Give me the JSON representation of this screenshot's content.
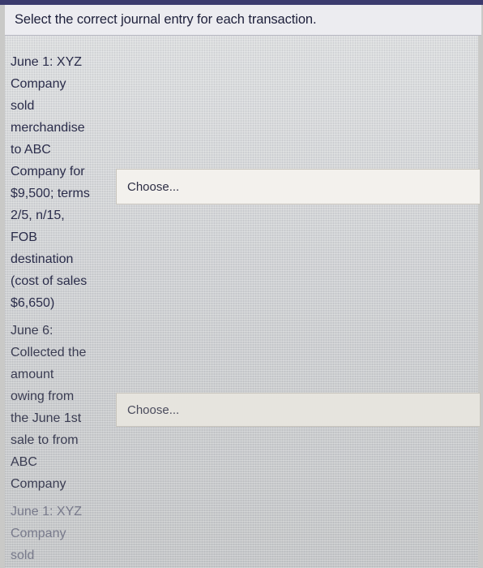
{
  "header": {
    "instruction": "Select the correct journal entry for each transaction."
  },
  "questions": [
    {
      "lines": [
        "June 1: XYZ",
        "Company",
        "sold",
        "merchandise",
        "to ABC",
        "Company for",
        "$9,500; terms",
        "2/5, n/15,",
        "FOB",
        "destination",
        "(cost of sales",
        "$6,650)"
      ],
      "select_value": "Choose..."
    },
    {
      "lines": [
        "June 6:",
        "Collected the",
        "amount",
        "owing from",
        "the June 1st",
        "sale to from",
        "ABC",
        "Company"
      ],
      "select_value": "Choose..."
    },
    {
      "lines": [
        "June 1: XYZ",
        "Company",
        "sold"
      ]
    }
  ]
}
